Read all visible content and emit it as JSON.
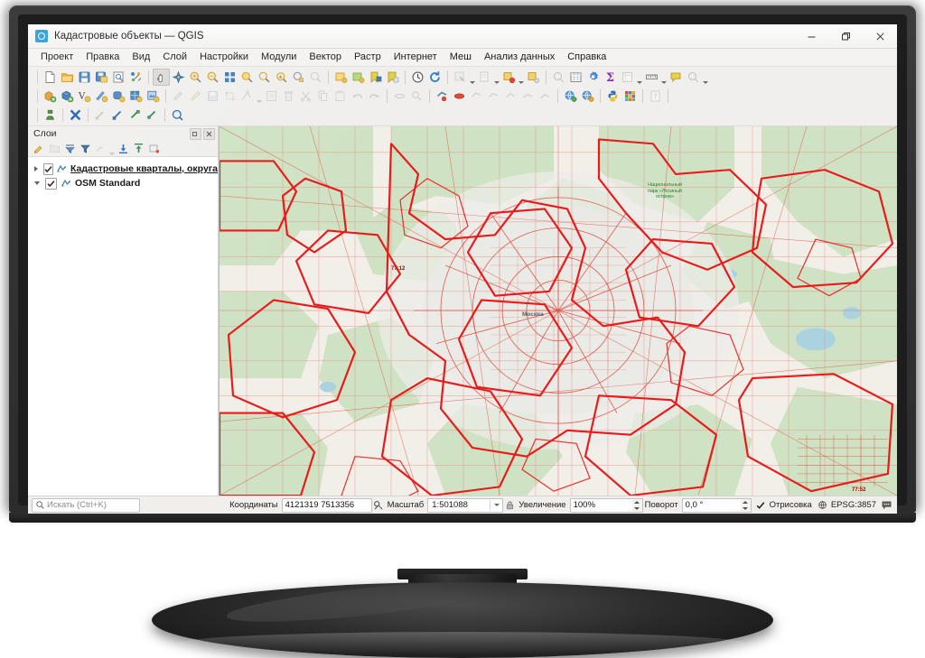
{
  "window": {
    "title": "Кадастровые объекты — QGIS",
    "app_icon": "qgis-icon",
    "controls": {
      "minimize": "minimize-button",
      "restore": "restore-button",
      "close": "close-button"
    }
  },
  "menubar": {
    "items": [
      {
        "label": "Проект",
        "name": "menu-project"
      },
      {
        "label": "Правка",
        "name": "menu-edit"
      },
      {
        "label": "Вид",
        "name": "menu-view"
      },
      {
        "label": "Слой",
        "name": "menu-layer"
      },
      {
        "label": "Настройки",
        "name": "menu-settings"
      },
      {
        "label": "Модули",
        "name": "menu-plugins"
      },
      {
        "label": "Вектор",
        "name": "menu-vector"
      },
      {
        "label": "Растр",
        "name": "menu-raster"
      },
      {
        "label": "Интернет",
        "name": "menu-web"
      },
      {
        "label": "Меш",
        "name": "menu-mesh"
      },
      {
        "label": "Анализ данных",
        "name": "menu-data-analysis"
      },
      {
        "label": "Справка",
        "name": "menu-help"
      }
    ]
  },
  "toolbar": {
    "row1": [
      {
        "icon": "new-project-icon",
        "label": "Создать проект"
      },
      {
        "icon": "open-project-icon",
        "label": "Открыть проект"
      },
      {
        "icon": "save-project-icon",
        "label": "Сохранить проект"
      },
      {
        "icon": "save-project-as-icon",
        "label": "Сохранить проект как"
      },
      {
        "icon": "print-layout-icon",
        "label": "Макет"
      },
      {
        "icon": "style-manager-icon",
        "label": "Менеджер стилей"
      },
      {
        "icon": "pan-map-icon",
        "label": "Переместить карту"
      },
      {
        "icon": "pan-to-selection-icon",
        "label": "Переместить к выделению"
      },
      {
        "icon": "zoom-in-icon",
        "label": "Приблизить"
      },
      {
        "icon": "zoom-out-icon",
        "label": "Отдалить"
      },
      {
        "icon": "zoom-full-icon",
        "label": "Полный охват"
      },
      {
        "icon": "zoom-selection-icon",
        "label": "Охват выделенного"
      },
      {
        "icon": "zoom-layer-icon",
        "label": "Охват слоя"
      },
      {
        "icon": "zoom-native-icon",
        "label": "Исходное разрешение"
      },
      {
        "icon": "zoom-last-icon",
        "label": "Предыдущий охват"
      },
      {
        "icon": "zoom-next-icon",
        "label": "Следующий охват"
      },
      {
        "icon": "new-map-view-icon",
        "label": "Новый вид карты"
      },
      {
        "icon": "new-3d-view-icon",
        "label": "Новый 3D вид"
      },
      {
        "icon": "bookmarks-icon",
        "label": "Закладки"
      },
      {
        "icon": "new-bookmark-icon",
        "label": "Новая закладка"
      },
      {
        "icon": "temporal-control-icon",
        "label": "Временной контроль"
      },
      {
        "icon": "refresh-icon",
        "label": "Обновить"
      },
      {
        "icon": "identify-features-icon",
        "label": "Определить объекты"
      },
      {
        "icon": "measure-icon",
        "label": "Измерить"
      },
      {
        "icon": "select-features-icon",
        "label": "Выделить объекты"
      },
      {
        "icon": "deselect-icon",
        "label": "Снять выделение"
      },
      {
        "icon": "select-by-expression-icon",
        "label": "Выделить по выражению"
      },
      {
        "icon": "attribute-table-icon",
        "label": "Таблица атрибутов"
      },
      {
        "icon": "processing-toolbox-icon",
        "label": "Модули обработки"
      },
      {
        "icon": "statistics-icon",
        "label": "Статистика"
      },
      {
        "icon": "open-table-icon",
        "label": "Открыть таблицу"
      },
      {
        "icon": "measure-line-icon",
        "label": "Измерить линию"
      },
      {
        "icon": "map-tips-icon",
        "label": "Подсказки карты"
      },
      {
        "icon": "search-features-icon",
        "label": "Поиск объектов"
      }
    ],
    "row2": [
      {
        "icon": "add-vector-layer-icon",
        "label": "Добавить векторный слой"
      },
      {
        "icon": "add-raster-layer-icon",
        "label": "Добавить растровый слой"
      },
      {
        "icon": "add-delimited-text-icon",
        "label": "Добавить текстовый слой"
      },
      {
        "icon": "add-spatialite-icon",
        "label": "Добавить слой SpatiaLite"
      },
      {
        "icon": "add-postgis-icon",
        "label": "Добавить слой PostGIS"
      },
      {
        "icon": "add-wms-icon",
        "label": "Добавить слой WMS/WMTS"
      },
      {
        "icon": "add-wfs-icon",
        "label": "Добавить слой WFS"
      },
      {
        "icon": "current-edits-icon",
        "label": "Текущие правки"
      },
      {
        "icon": "toggle-editing-icon",
        "label": "Режим редактирования"
      },
      {
        "icon": "save-layer-edits-icon",
        "label": "Сохранить правки слоя"
      },
      {
        "icon": "add-feature-icon",
        "label": "Добавить объект"
      },
      {
        "icon": "vertex-tool-icon",
        "label": "Редактор узлов"
      },
      {
        "icon": "modify-attributes-icon",
        "label": "Изменить атрибуты"
      },
      {
        "icon": "delete-selected-icon",
        "label": "Удалить выделенное"
      },
      {
        "icon": "cut-features-icon",
        "label": "Вырезать объекты"
      },
      {
        "icon": "copy-features-icon",
        "label": "Копировать объекты"
      },
      {
        "icon": "paste-features-icon",
        "label": "Вставить объекты"
      },
      {
        "icon": "undo-icon",
        "label": "Отменить"
      },
      {
        "icon": "redo-icon",
        "label": "Повторить"
      },
      {
        "icon": "pan-selection-icon",
        "label": "Переместить выделение"
      },
      {
        "icon": "deselect-all-icon",
        "label": "Снять всё выделение"
      },
      {
        "icon": "select-polygon-icon",
        "label": "Выделить полигоном"
      },
      {
        "icon": "select-freehand-icon",
        "label": "Выделить от руки"
      },
      {
        "icon": "select-radius-icon",
        "label": "Выделить радиусом"
      },
      {
        "icon": "select-value-icon",
        "label": "Выделить по значению"
      },
      {
        "icon": "select-form-icon",
        "label": "Выделить по форме"
      },
      {
        "icon": "select-expr-icon",
        "label": "Выделить выражением"
      },
      {
        "icon": "select-invert-icon",
        "label": "Инвертировать выделение"
      },
      {
        "icon": "osm-download-icon",
        "label": "Загрузить данные OSM"
      },
      {
        "icon": "metasearch-icon",
        "label": "Каталог MetaSearch"
      },
      {
        "icon": "python-console-icon",
        "label": "Консоль Python"
      },
      {
        "icon": "plugin-manager-icon",
        "label": "Управление модулями"
      },
      {
        "icon": "help-contents-icon",
        "label": "Содержание справки"
      }
    ],
    "row3": [
      {
        "icon": "georeferencer-icon",
        "label": "Привязка растров"
      },
      {
        "icon": "close-editing-icon",
        "label": "Прервать"
      },
      {
        "icon": "snapping-enable-icon",
        "label": "Включить прилипание"
      },
      {
        "icon": "snapping-vertex-icon",
        "label": "Прилипание к узлам"
      },
      {
        "icon": "snapping-segment-icon",
        "label": "Прилипание к сегментам"
      },
      {
        "icon": "snapping-options-icon",
        "label": "Параметры прилипания"
      },
      {
        "icon": "zoom-magnifier-icon",
        "label": "Лупа"
      }
    ]
  },
  "panel": {
    "title": "Слои",
    "undock_button": "undock-panel-button",
    "close_button": "close-panel-button",
    "tools": [
      {
        "icon": "open-layer-styling-icon",
        "label": "Стиль слоя"
      },
      {
        "icon": "add-group-icon",
        "label": "Добавить группу"
      },
      {
        "icon": "filter-legend-icon",
        "label": "Фильтровать легенду"
      },
      {
        "icon": "filter-expression-icon",
        "label": "Фильтр по выражению"
      },
      {
        "icon": "expand-all-icon",
        "label": "Развернуть все"
      },
      {
        "icon": "collapse-dropdown-icon",
        "label": "Список"
      },
      {
        "icon": "expand-tree-icon",
        "label": "Развернуть дерево"
      },
      {
        "icon": "collapse-tree-icon",
        "label": "Свернуть дерево"
      },
      {
        "icon": "remove-layer-icon",
        "label": "Удалить слой"
      }
    ],
    "layers": [
      {
        "name": "Кадастровые квартaлы, округа",
        "checked": true,
        "expanded": false,
        "type_icon": "vector-polygon-icon",
        "underlined": true
      },
      {
        "name": "OSM Standard",
        "checked": true,
        "expanded": true,
        "type_icon": "raster-layer-icon",
        "underlined": false
      }
    ]
  },
  "map": {
    "labels": [
      {
        "text": "Национальный\nпарк «Лосиный\nостров»",
        "kind": "park-label"
      },
      {
        "text": "77:12",
        "kind": "cadastral-label"
      },
      {
        "text": "Москва",
        "kind": "city-label"
      },
      {
        "text": "77:52",
        "kind": "cadastral-label"
      }
    ],
    "colors": {
      "base_forest": "#cfe3c4",
      "base_land": "#f2efe9",
      "base_urban": "#e8e6e3",
      "cadastral_boundary": "#e81a1a",
      "cadastral_fill": "rgba(232,26,26,0.05)",
      "water": "#aad3df"
    }
  },
  "statusbar": {
    "search_placeholder": "Искать (Ctrl+K)",
    "search_icon": "search-icon",
    "coordinates_label": "Координаты",
    "coordinates_value": "4121319 7513356",
    "coordinate_toggle_icon": "coordinate-capture-icon",
    "scale_label": "Масштаб",
    "scale_value": "1:501088",
    "lock_icon": "lock-scale-icon",
    "magnification_label": "Увеличение",
    "magnification_value": "100%",
    "rotation_label": "Поворот",
    "rotation_value": "0,0 °",
    "render_label": "Отрисовка",
    "render_checked": true,
    "crs_label": "EPSG:3857",
    "crs_icon": "projection-icon",
    "messages_icon": "messages-icon"
  }
}
